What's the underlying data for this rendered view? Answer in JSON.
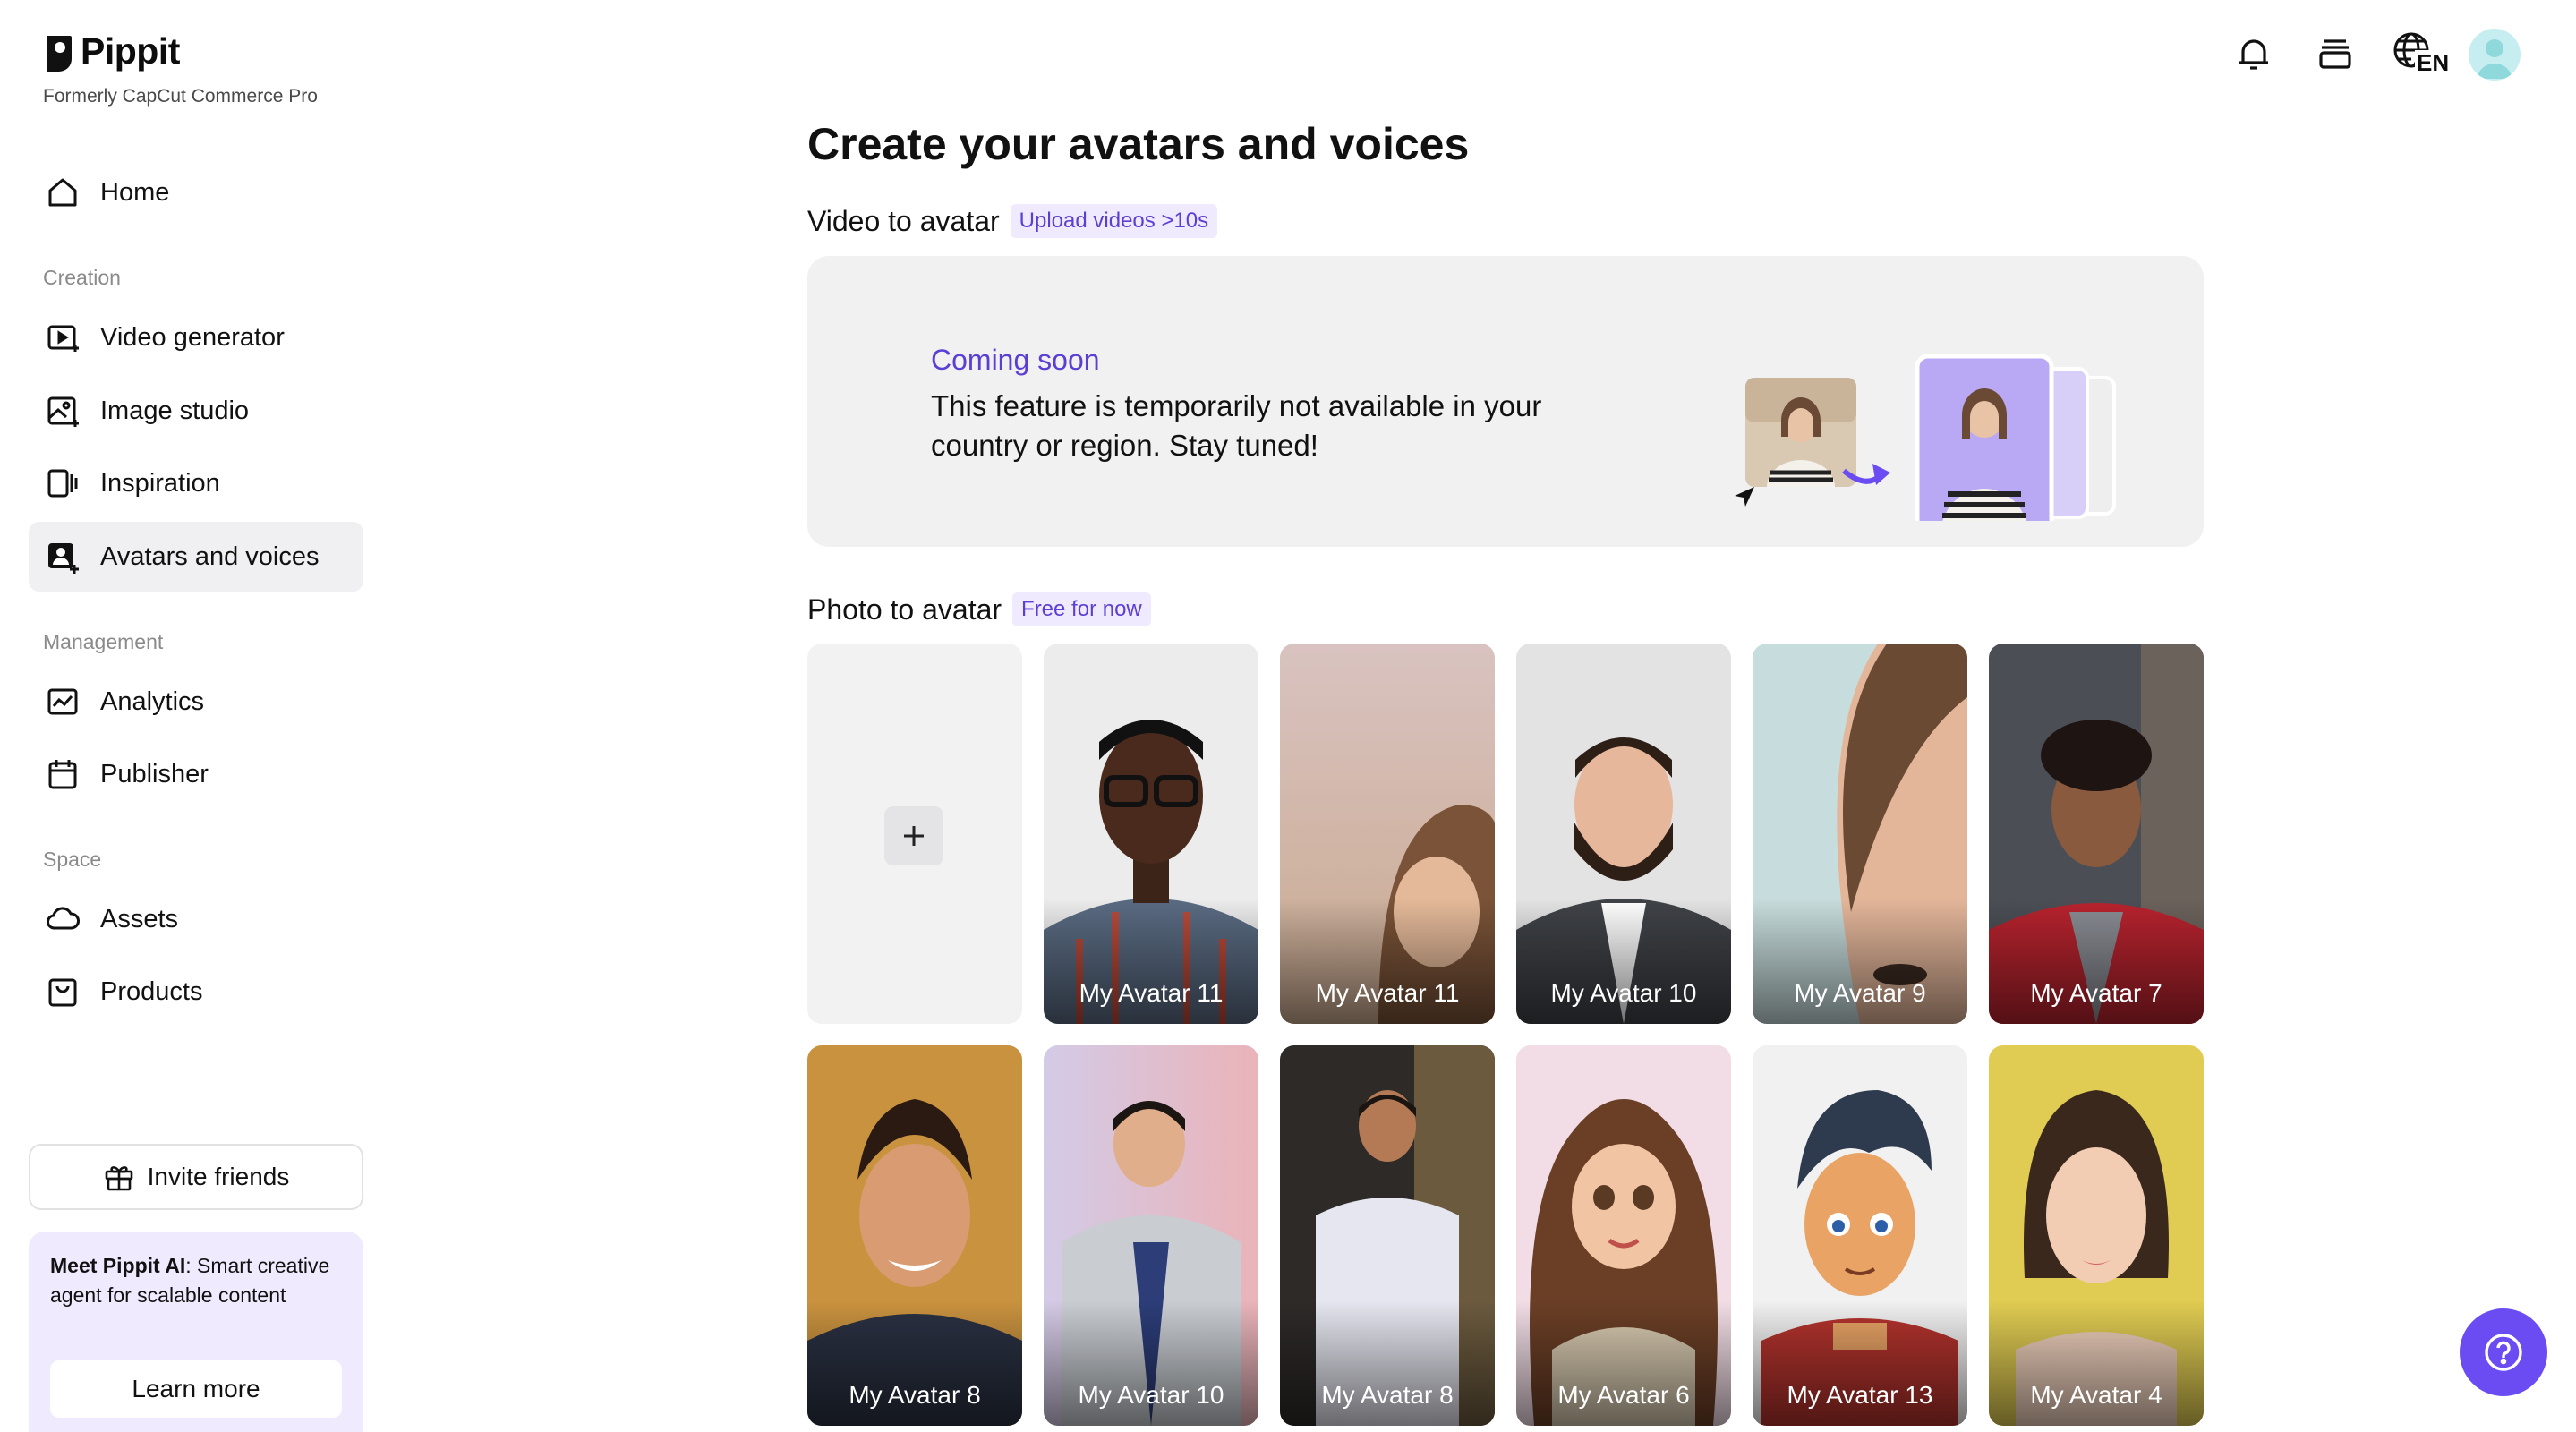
{
  "brand": {
    "name": "Pippit",
    "subtitle": "Formerly CapCut Commerce Pro"
  },
  "sidebar": {
    "home": "Home",
    "sections": {
      "creation": "Creation",
      "management": "Management",
      "space": "Space"
    },
    "items": [
      {
        "label": "Video generator",
        "icon": "video-generator-icon"
      },
      {
        "label": "Image studio",
        "icon": "image-studio-icon"
      },
      {
        "label": "Inspiration",
        "icon": "inspiration-icon"
      },
      {
        "label": "Avatars and voices",
        "icon": "avatar-icon",
        "active": true
      },
      {
        "label": "Analytics",
        "icon": "analytics-icon"
      },
      {
        "label": "Publisher",
        "icon": "calendar-icon"
      },
      {
        "label": "Assets",
        "icon": "cloud-icon"
      },
      {
        "label": "Products",
        "icon": "bag-icon"
      }
    ],
    "invite_label": "Invite friends",
    "promo": {
      "bold": "Meet Pippit AI",
      "text": ": Smart creative agent for scalable content",
      "button": "Learn more"
    }
  },
  "topbar": {
    "language": "EN",
    "icons": [
      "bell-icon",
      "stack-icon",
      "globe-icon",
      "profile-avatar"
    ]
  },
  "main": {
    "title": "Create your avatars and voices",
    "video_section": {
      "title": "Video to avatar",
      "badge": "Upload videos >10s",
      "coming_title": "Coming soon",
      "coming_body": "This feature is temporarily not available in your country or region. Stay tuned!"
    },
    "photo_section": {
      "title": "Photo to avatar",
      "badge": "Free for now"
    },
    "avatars_row1": [
      {
        "label": "My Avatar 11"
      },
      {
        "label": "My Avatar 11"
      },
      {
        "label": "My Avatar 10"
      },
      {
        "label": "My Avatar 9"
      },
      {
        "label": "My Avatar 7"
      }
    ],
    "avatars_row2": [
      {
        "label": "My Avatar 8"
      },
      {
        "label": "My Avatar 10"
      },
      {
        "label": "My Avatar 8"
      },
      {
        "label": "My Avatar 6"
      },
      {
        "label": "My Avatar 13"
      },
      {
        "label": "My Avatar 4"
      }
    ]
  },
  "colors": {
    "accent": "#5b3fd4",
    "help_button": "#6a4cf2",
    "badge_bg": "#efeafd",
    "active_nav_bg": "#f0f0f2"
  }
}
